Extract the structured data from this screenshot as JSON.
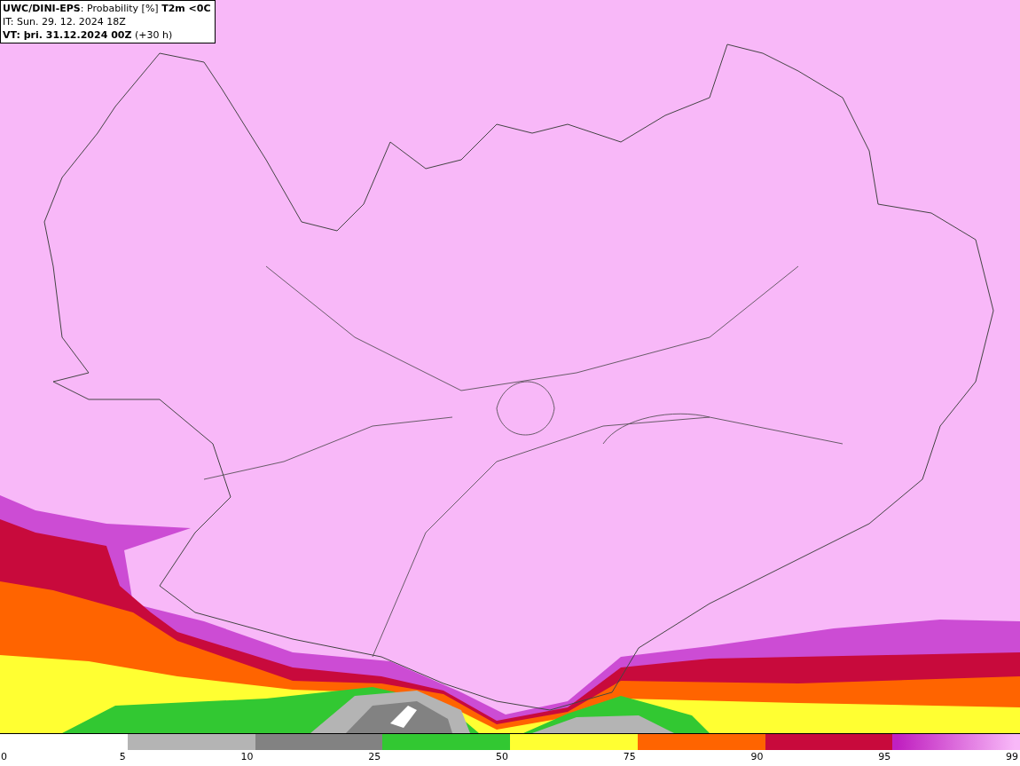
{
  "header": {
    "title": "**UWC/DINI-EPS**: Probability [%] **T2m <0C**",
    "init_time": "IT: Sun. 29. 12. 2024 18Z",
    "valid_time": "**VT: þri. 31.12.2024 00Z** (+30 h)"
  },
  "legend": {
    "segments": [
      {
        "kind": "empty"
      },
      {
        "kind": "solid",
        "color": "#b4b4b4"
      },
      {
        "kind": "solid",
        "color": "#828282"
      },
      {
        "kind": "solid",
        "color": "#32c832"
      },
      {
        "kind": "solid",
        "color": "#ffff32"
      },
      {
        "kind": "solid",
        "color": "#ff6400"
      },
      {
        "kind": "solid",
        "color": "#c80a3c"
      },
      {
        "kind": "gradient",
        "stops": [
          {
            "color": "#c020c0"
          },
          {
            "color": "#f8b8f8"
          }
        ]
      }
    ],
    "ticks": [
      "0",
      "5",
      "10",
      "25",
      "50",
      "75",
      "90",
      "95",
      "99"
    ]
  }
}
